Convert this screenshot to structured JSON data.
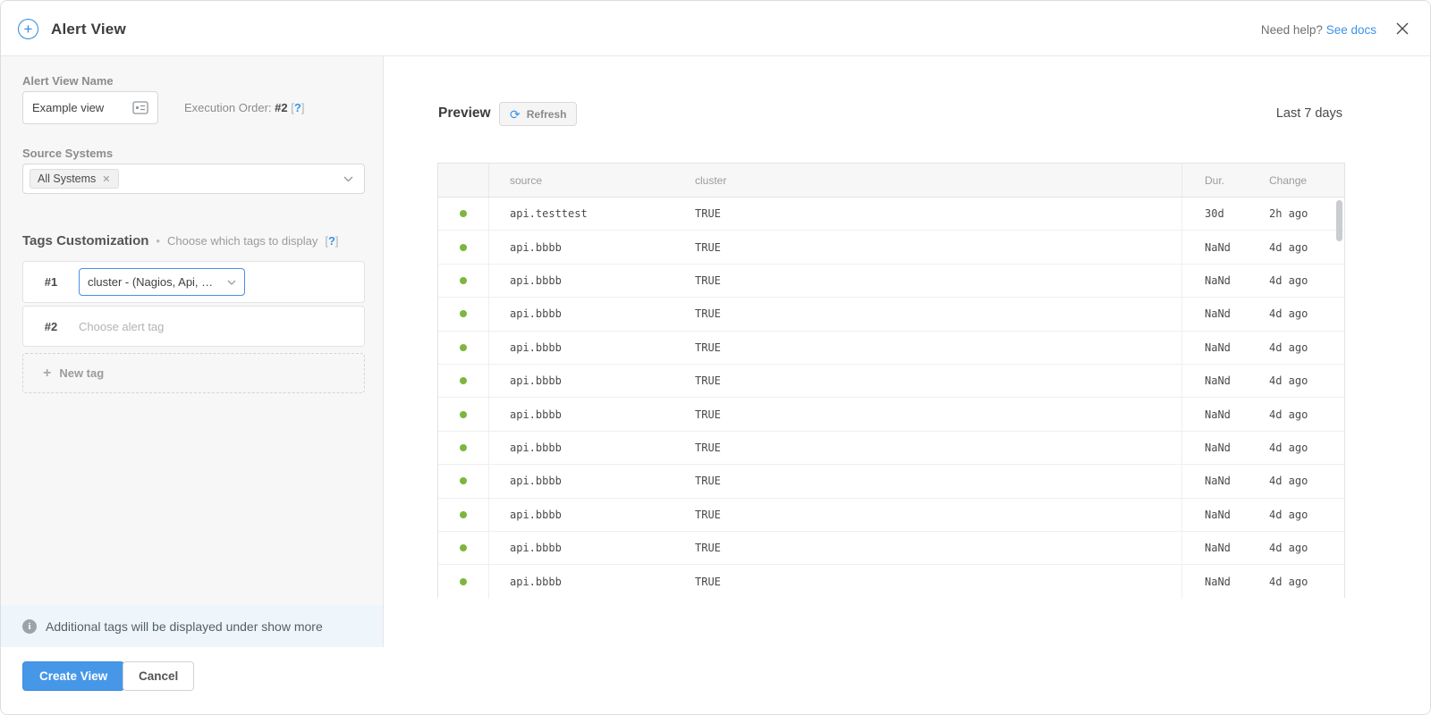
{
  "header": {
    "title": "Alert View",
    "need_help": "Need help?",
    "see_docs": "See docs"
  },
  "sidebar": {
    "name_label": "Alert View Name",
    "name_value": "Example view",
    "execution_order_label": "Execution Order:",
    "execution_order_value": "#2",
    "help_open_bracket": "[",
    "help_mark": "?",
    "help_close_bracket": "]",
    "source_systems_label": "Source Systems",
    "source_chip": "All Systems",
    "chip_remove": "✕",
    "tags_title": "Tags Customization",
    "tags_bullet": "•",
    "tags_subtitle": "Choose which tags to display",
    "tag_rows": [
      {
        "index": "#1",
        "value": "cluster - (Nagios, Api, …"
      },
      {
        "index": "#2",
        "placeholder": "Choose alert tag"
      }
    ],
    "new_tag_plus": "+",
    "new_tag_label": "New tag",
    "info_icon_glyph": "i",
    "info_note": "Additional tags will be displayed under show more"
  },
  "footer": {
    "create_label": "Create View",
    "cancel_label": "Cancel"
  },
  "preview": {
    "title": "Preview",
    "refresh_icon": "⟳",
    "refresh_label": "Refresh",
    "time_range": "Last 7 days",
    "table": {
      "columns": [
        "",
        "source",
        "cluster",
        "Dur.",
        "Change"
      ],
      "rows": [
        {
          "status": "ok",
          "source": "api.testtest",
          "cluster": "TRUE",
          "dur": "30d",
          "change": "2h ago"
        },
        {
          "status": "ok",
          "source": "api.bbbb",
          "cluster": "TRUE",
          "dur": "NaNd",
          "change": "4d ago"
        },
        {
          "status": "ok",
          "source": "api.bbbb",
          "cluster": "TRUE",
          "dur": "NaNd",
          "change": "4d ago"
        },
        {
          "status": "ok",
          "source": "api.bbbb",
          "cluster": "TRUE",
          "dur": "NaNd",
          "change": "4d ago"
        },
        {
          "status": "ok",
          "source": "api.bbbb",
          "cluster": "TRUE",
          "dur": "NaNd",
          "change": "4d ago"
        },
        {
          "status": "ok",
          "source": "api.bbbb",
          "cluster": "TRUE",
          "dur": "NaNd",
          "change": "4d ago"
        },
        {
          "status": "ok",
          "source": "api.bbbb",
          "cluster": "TRUE",
          "dur": "NaNd",
          "change": "4d ago"
        },
        {
          "status": "ok",
          "source": "api.bbbb",
          "cluster": "TRUE",
          "dur": "NaNd",
          "change": "4d ago"
        },
        {
          "status": "ok",
          "source": "api.bbbb",
          "cluster": "TRUE",
          "dur": "NaNd",
          "change": "4d ago"
        },
        {
          "status": "ok",
          "source": "api.bbbb",
          "cluster": "TRUE",
          "dur": "NaNd",
          "change": "4d ago"
        },
        {
          "status": "ok",
          "source": "api.bbbb",
          "cluster": "TRUE",
          "dur": "NaNd",
          "change": "4d ago"
        },
        {
          "status": "ok",
          "source": "api.bbbb",
          "cluster": "TRUE",
          "dur": "NaNd",
          "change": "4d ago"
        }
      ]
    }
  },
  "colors": {
    "accent_blue": "#3a93e8",
    "primary_button": "#4697e7",
    "selected_border": "#4a90e2",
    "status_ok_green": "#7db63f",
    "sidebar_bg": "#f7f7f7",
    "info_bg": "#eef6fb"
  }
}
